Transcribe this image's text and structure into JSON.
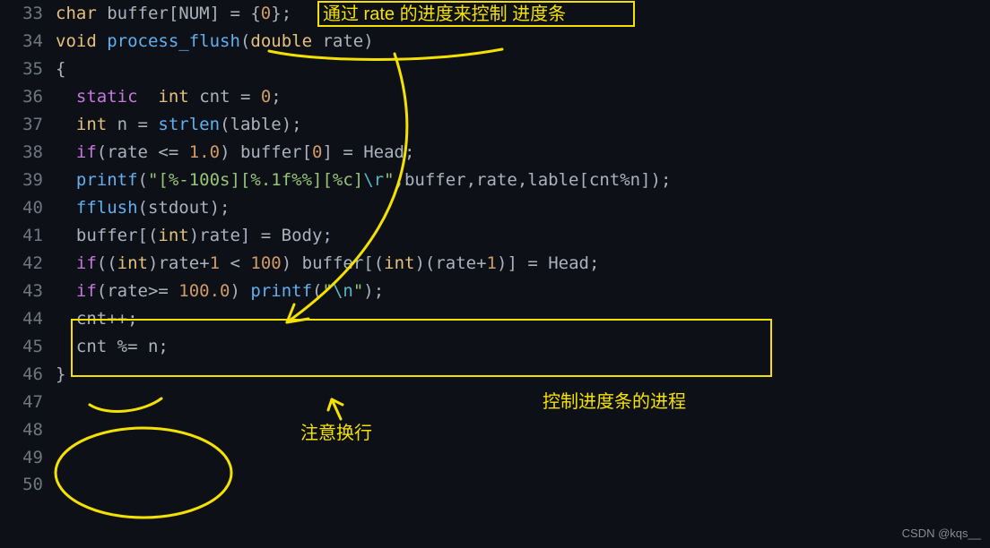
{
  "language": "c",
  "theme": "one-dark",
  "first_line_number": 33,
  "lines": {
    "l33": {
      "num": "33",
      "t1": "char",
      "t2": " buffer[NUM] = {",
      "t3": "0",
      "t4": "};"
    },
    "l34": {
      "num": "34",
      "t1": "void",
      "t2": " ",
      "t3": "process_flush",
      "t4": "(",
      "t5": "double",
      "t6": " rate)"
    },
    "l35": {
      "num": "35",
      "t1": "{"
    },
    "l36": {
      "num": "36",
      "t1": ""
    },
    "l37": {
      "num": "37",
      "t1": "  ",
      "t2": "static",
      "t3": "  ",
      "t4": "int",
      "t5": " cnt = ",
      "t6": "0",
      "t7": ";"
    },
    "l38": {
      "num": "38",
      "t1": "  ",
      "t2": "int",
      "t3": " n = ",
      "t4": "strlen",
      "t5": "(lable);"
    },
    "l39": {
      "num": "39",
      "t1": "  ",
      "t2": "if",
      "t3": "(rate <= ",
      "t4": "1.0",
      "t5": ") buffer[",
      "t6": "0",
      "t7": "] = Head;"
    },
    "l40": {
      "num": "40",
      "t1": ""
    },
    "l41": {
      "num": "41",
      "t1": "  ",
      "t2": "printf",
      "t3": "(",
      "s1": "\"[%-100s][%.1f%%][%c]",
      "s2": "\\r",
      "s3": "\"",
      "t4": ",buffer,rate,lable[cnt%n]);"
    },
    "l42": {
      "num": "42",
      "t1": ""
    },
    "l43": {
      "num": "43",
      "t1": "  ",
      "t2": "fflush",
      "t3": "(stdout);"
    },
    "l44": {
      "num": "44",
      "t1": "  buffer[(",
      "t2": "int",
      "t3": ")rate] = Body;"
    },
    "l45": {
      "num": "45",
      "t1": "  ",
      "t2": "if",
      "t3": "((",
      "t4": "int",
      "t5": ")rate+",
      "t6": "1",
      "t7": " < ",
      "t8": "100",
      "t9": ") buffer[(",
      "t10": "int",
      "t11": ")(rate+",
      "t12": "1",
      "t13": ")] = Head;"
    },
    "l46": {
      "num": "46",
      "t1": "  ",
      "t2": "if",
      "t3": "(rate>= ",
      "t4": "100.0",
      "t5": ") ",
      "t6": "printf",
      "t7": "(",
      "s1": "\"",
      "s2": "\\n",
      "s3": "\"",
      "t8": ");"
    },
    "l47": {
      "num": "47",
      "t1": ""
    },
    "l48": {
      "num": "48",
      "t1": "  cnt++;"
    },
    "l49": {
      "num": "49",
      "t1": "  cnt %= n;"
    },
    "l50": {
      "num": "50",
      "t1": "}"
    }
  },
  "annotations": {
    "top_box_text": "通过 rate 的进度来控制 进度条",
    "right_note": "控制进度条的进程",
    "mid_note": "注意换行",
    "colors": {
      "stroke": "#f5e100",
      "text": "#f5e100"
    }
  },
  "watermark": "CSDN @kqs__"
}
